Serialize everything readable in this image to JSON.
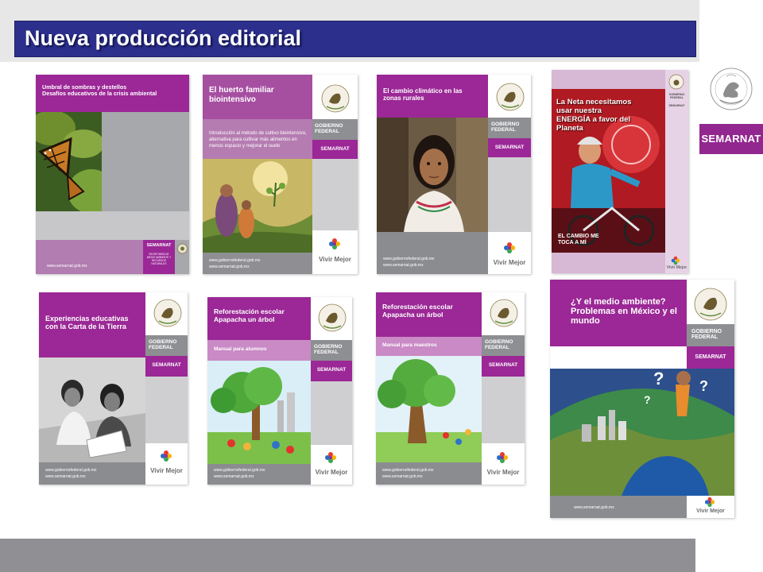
{
  "slide": {
    "title": "Nueva producción editorial"
  },
  "brand": {
    "label": "SEMARNAT",
    "seal_icon": "mexican-coat-of-arms"
  },
  "covers": [
    {
      "id": "umbral",
      "title": "Umbral de sombras y destellos\nDesafíos educativos de la crisis ambiental",
      "org": "SEMARNAT",
      "org_sub": "SECRETARÍA DE MEDIO AMBIENTE Y RECURSOS NATURALES",
      "url": "www.semarnat.gob.mx",
      "image": "butterfly-on-leaves"
    },
    {
      "id": "huerto",
      "title": "El huerto familiar biointensivo",
      "subtitle": "Introducción al método de cultivo biointensivo, alternativa para cultivar más alimentos en menos espacio y mejorar el suelo",
      "gov": "GOBIERNO FEDERAL",
      "org": "SEMARNAT",
      "vivir": "Vivir Mejor",
      "urls": [
        "www.gobiernofederal.gob.mx",
        "www.semarnat.gob.mx"
      ],
      "image": "family-garden-illustration"
    },
    {
      "id": "clima",
      "title": "El cambio climático en las zonas rurales",
      "gov": "GOBIERNO FEDERAL",
      "org": "SEMARNAT",
      "vivir": "Vivir Mejor",
      "urls": [
        "www.gobiernofederal.gob.mx",
        "www.semarnat.gob.mx"
      ],
      "image": "rural-girl-portrait"
    },
    {
      "id": "neta",
      "title": "La Neta necesitamos usar nuestra ENERGÍA a favor del Planeta",
      "gov": "GOBIERNO FEDERAL",
      "org": "SEMARNAT",
      "bottom": "EL CAMBIO ME TOCA A MÍ",
      "vivir": "Vivir Mejor",
      "image": "cyclist-red-background"
    },
    {
      "id": "carta",
      "title": "Experiencias educativas con la Carta de la Tierra",
      "gov": "GOBIERNO FEDERAL",
      "org": "SEMARNAT",
      "vivir": "Vivir Mejor",
      "urls": [
        "www.gobiernofederal.gob.mx",
        "www.semarnat.gob.mx"
      ],
      "image": "two-girls-reading-bw"
    },
    {
      "id": "refo-alumnos",
      "title": "Reforestación escolar Apapacha un árbol",
      "subtitle": "Manual para alumnos",
      "gov": "GOBIERNO FEDERAL",
      "org": "SEMARNAT",
      "vivir": "Vivir Mejor",
      "urls": [
        "www.gobiernofederal.gob.mx",
        "www.semarnat.gob.mx"
      ],
      "image": "children-planting-tree"
    },
    {
      "id": "refo-maestros",
      "title": "Reforestación escolar Apapacha un árbol",
      "subtitle": "Manual para maestros",
      "gov": "GOBIERNO FEDERAL",
      "org": "SEMARNAT",
      "vivir": "Vivir Mejor",
      "urls": [
        "www.gobiernofederal.gob.mx",
        "www.semarnat.gob.mx"
      ],
      "image": "big-tree-playground"
    },
    {
      "id": "medio",
      "title": "¿Y el medio ambiente? Problemas en México y el mundo",
      "gov": "GOBIERNO FEDERAL",
      "org": "SEMARNAT",
      "vivir": "Vivir Mejor",
      "url": "www.semarnat.gob.mx",
      "image": "earth-city-thinking-man"
    }
  ]
}
